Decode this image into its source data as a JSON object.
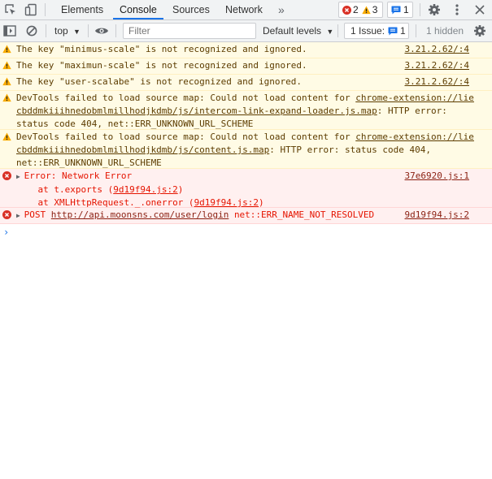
{
  "tabs": [
    {
      "label": "Elements",
      "active": false
    },
    {
      "label": "Console",
      "active": true
    },
    {
      "label": "Sources",
      "active": false
    },
    {
      "label": "Network",
      "active": false
    }
  ],
  "more_tabs": "»",
  "counters": {
    "errors": "2",
    "warnings": "3",
    "messages": "1"
  },
  "toolbar": {
    "context": "top",
    "filter_placeholder": "Filter",
    "levels": "Default levels",
    "issues_label": "1 Issue:",
    "issues_count": "1",
    "hidden": "1 hidden"
  },
  "messages": [
    {
      "level": "warning",
      "text": "The key \"minimus-scale\" is not recognized and ignored.",
      "source": "3.21.2.62/:4"
    },
    {
      "level": "warning",
      "text": "The key \"maximun-scale\" is not recognized and ignored.",
      "source": "3.21.2.62/:4"
    },
    {
      "level": "warning",
      "text": "The key \"user-scalabe\" is not recognized and ignored.",
      "source": "3.21.2.62/:4"
    },
    {
      "level": "warning",
      "pre": "DevTools failed to load source map: Could not load content for ",
      "link1": "chrome-extension://lie",
      "link2": "cbddmkiiihnedobmlmillhodjkdmb/js/intercom-link-expand-loader.js.map",
      "post2": ": HTTP error:",
      "line3": "status code 404, net::ERR_UNKNOWN_URL_SCHEME"
    },
    {
      "level": "warning",
      "pre": "DevTools failed to load source map: Could not load content for ",
      "link1": "chrome-extension://lie",
      "link2": "cbddmkiiihnedobmlmillhodjkdmb/js/content.js.map",
      "post2": ": HTTP error: status code 404,",
      "line3": "net::ERR_UNKNOWN_URL_SCHEME"
    },
    {
      "level": "error",
      "text": "Error: Network Error",
      "source": "37e6920.js:1",
      "stack": [
        {
          "pre": "at t.exports (",
          "link": "9d19f94.js:2",
          "post": ")"
        },
        {
          "pre": "at XMLHttpRequest._.onerror (",
          "link": "9d19f94.js:2",
          "post": ")"
        }
      ]
    },
    {
      "level": "error",
      "method": "POST",
      "url": "http://api.moonsns.com/user/login",
      "text": "net::ERR_NAME_NOT_RESOLVED",
      "source": "9d19f94.js:2"
    }
  ],
  "prompt": "›"
}
